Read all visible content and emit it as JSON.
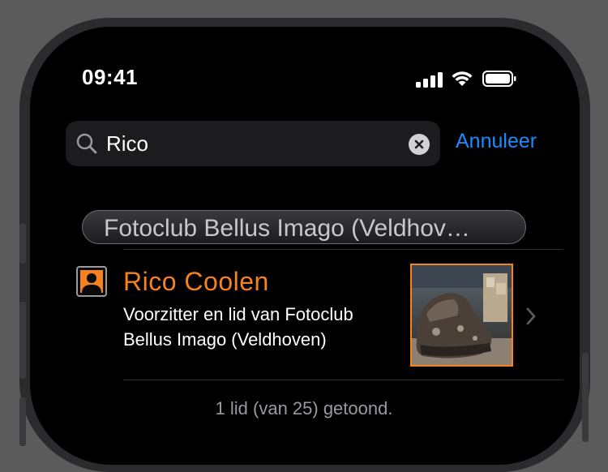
{
  "status_bar": {
    "time": "09:41"
  },
  "search": {
    "query": "Rico",
    "cancel_label": "Annuleer"
  },
  "results": {
    "group_title": "Fotoclub Bellus Imago (Veldhov…",
    "member": {
      "name": "Rico Coolen",
      "role_line1": "Voorzitter en lid van Fotoclub",
      "role_line2": "Bellus Imago (Veldhoven)"
    },
    "footer": "1 lid (van 25) getoond."
  },
  "colors": {
    "accent": "#f5821f",
    "link": "#1a8cff",
    "background": "#000000"
  },
  "icons": [
    "search-icon",
    "clear-icon",
    "person-icon",
    "chevron-right-icon",
    "signal-icon",
    "wifi-icon",
    "battery-icon"
  ]
}
